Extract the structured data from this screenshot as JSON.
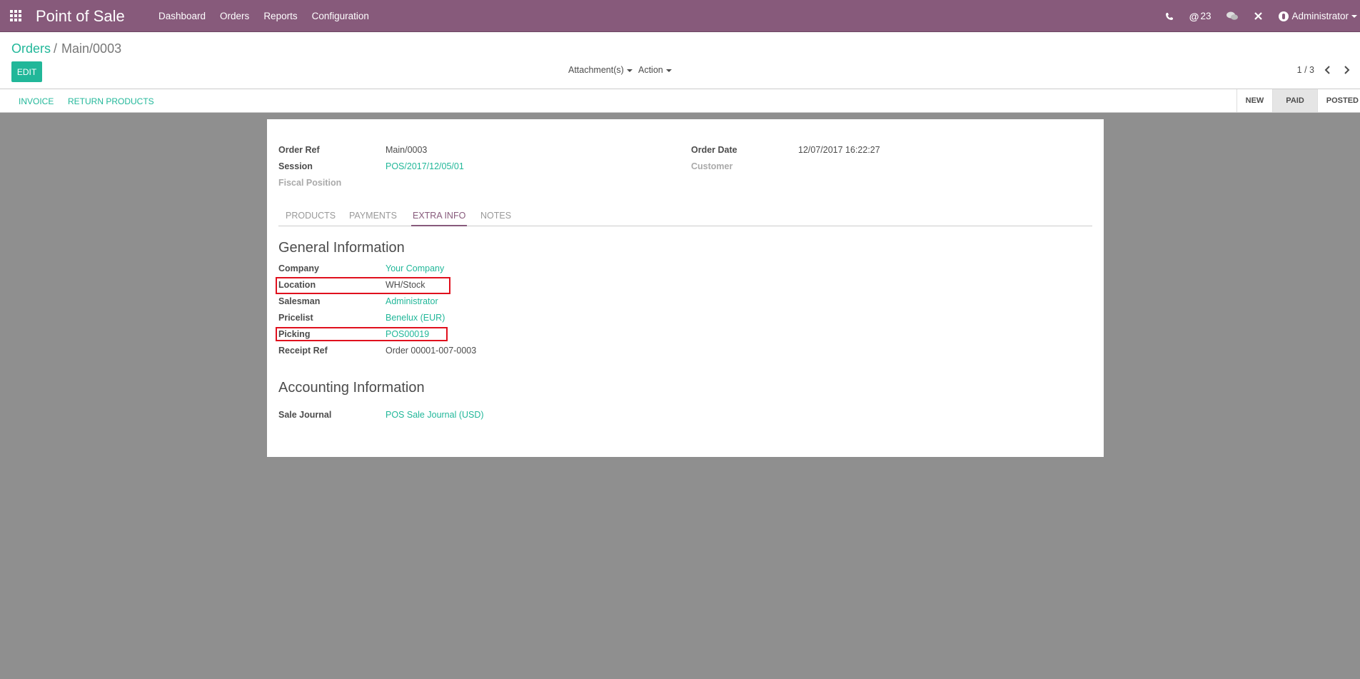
{
  "navbar": {
    "brand": "Point of Sale",
    "menu": [
      "Dashboard",
      "Orders",
      "Reports",
      "Configuration"
    ],
    "mentions_count": "23",
    "user": "Administrator"
  },
  "breadcrumb": {
    "parent": "Orders",
    "current": "Main/0003"
  },
  "toolbar": {
    "edit_label": "EDIT",
    "attachments_label": "Attachment(s)",
    "action_label": "Action",
    "pager": "1 / 3"
  },
  "statusbar": {
    "invoice_label": "INVOICE",
    "return_label": "RETURN PRODUCTS",
    "stages": [
      "NEW",
      "PAID",
      "POSTED"
    ],
    "active_stage": "PAID"
  },
  "order": {
    "order_ref_label": "Order Ref",
    "order_ref": "Main/0003",
    "session_label": "Session",
    "session": "POS/2017/12/05/01",
    "fiscal_position_label": "Fiscal Position",
    "order_date_label": "Order Date",
    "order_date": "12/07/2017 16:22:27",
    "customer_label": "Customer"
  },
  "tabs": [
    "PRODUCTS",
    "PAYMENTS",
    "EXTRA INFO",
    "NOTES"
  ],
  "general": {
    "title": "General Information",
    "company_label": "Company",
    "company": "Your Company",
    "location_label": "Location",
    "location": "WH/Stock",
    "salesman_label": "Salesman",
    "salesman": "Administrator",
    "pricelist_label": "Pricelist",
    "pricelist": "Benelux (EUR)",
    "picking_label": "Picking",
    "picking": "POS00019",
    "receipt_label": "Receipt Ref",
    "receipt": "Order 00001-007-0003"
  },
  "accounting": {
    "title": "Accounting Information",
    "journal_label": "Sale Journal",
    "journal": "POS Sale Journal (USD)"
  },
  "colors": {
    "brand": "#875a7b",
    "accent": "#21b799",
    "highlight": "#e0101d"
  }
}
